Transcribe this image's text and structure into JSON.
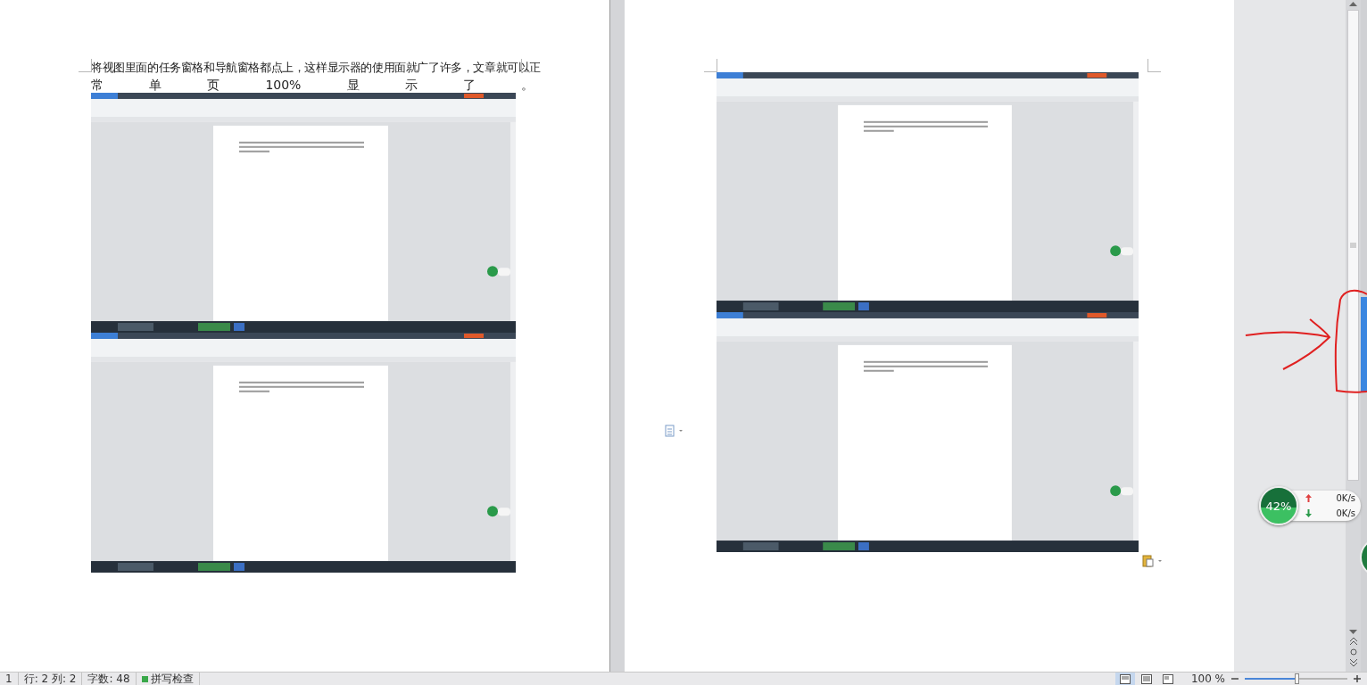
{
  "pages": [
    {
      "paragraph_line1": "将视图里面的任务窗格和导航窗格都点上，这样显示器的使用面就广了许多，文章就可以正",
      "paragraph_line2": [
        "常",
        "单",
        "页",
        "100%",
        "显",
        "示",
        "了",
        "。"
      ],
      "images": [
        {
          "kind": "screenshot"
        },
        {
          "kind": "screenshot"
        }
      ]
    },
    {
      "images": [
        {
          "kind": "screenshot"
        },
        {
          "kind": "screenshot"
        }
      ]
    }
  ],
  "net_widget": {
    "percent": "42%",
    "upload": "0K/s",
    "download": "0K/s"
  },
  "status_bar": {
    "items": [
      {
        "text": "1"
      },
      {
        "text": "行: 2  列: 2"
      },
      {
        "text": "字数: 48"
      },
      {
        "text": "拼写检查",
        "kind": "spellcheck"
      }
    ],
    "views": [
      {
        "selected": true
      },
      {
        "selected": false
      },
      {
        "selected": false
      }
    ],
    "zoom_label": "100 %",
    "zoom": {
      "level": 0.5
    }
  }
}
